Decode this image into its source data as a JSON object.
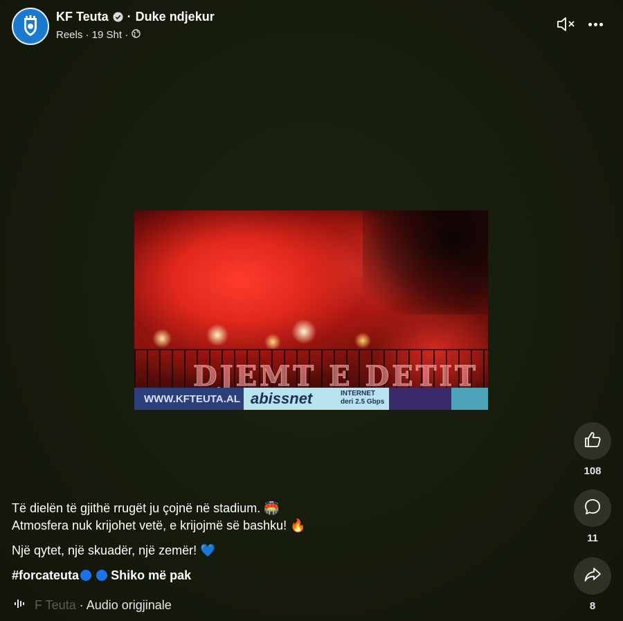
{
  "header": {
    "page_name": "KF Teuta",
    "separator": "·",
    "follow_status": "Duke ndjekur",
    "meta": "Reels · 19 Sht ·"
  },
  "icons": {
    "avatar": "kf-teuta-crest-icon",
    "verified": "verified-badge-icon",
    "privacy": "globe-icon",
    "mute": "speaker-muted-icon",
    "more": "more-options-icon",
    "like": "thumbs-up-icon",
    "comment": "comment-bubble-icon",
    "share": "share-arrow-icon",
    "audio": "audio-waveform-icon"
  },
  "media": {
    "banner_text": "DJEMT E DETIT",
    "ad_website": "WWW.KFTEUTA.AL",
    "ad_brand": "abissnet",
    "ad_internet_line1": "INTERNET",
    "ad_internet_line2": "deri 2.5 Gbps"
  },
  "actions": {
    "likes": "108",
    "comments": "11",
    "shares": "8"
  },
  "caption": {
    "line1": "Të dielën të gjithë rrugët ju çojnë në stadium. 🏟️",
    "line2": "Atmosfera nuk krijohet vetë, e krijojmë së bashku! 🔥",
    "line3": "Një qytet, një skuadër, një zemër! 💙",
    "hashtag": "#forcateuta",
    "see_more": "Shiko më pak"
  },
  "audio": {
    "author_faded": "F Teuta",
    "label": "· Audio origjinale"
  },
  "colors": {
    "background": "#161a0c",
    "action_button": "#2f3326",
    "avatar_blue": "#1a7ad0",
    "heart_blue": "#1a73e8"
  }
}
